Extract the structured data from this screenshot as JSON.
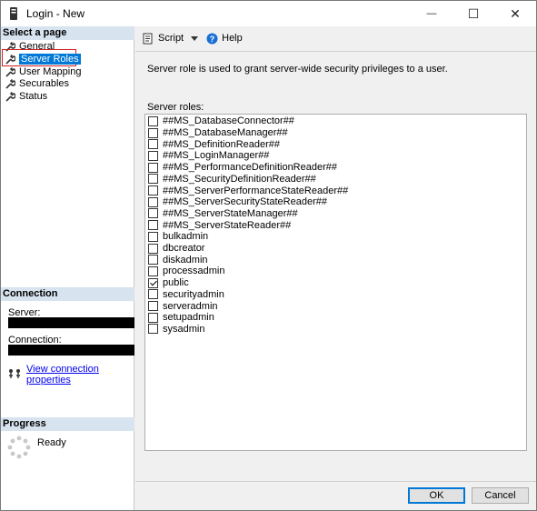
{
  "window": {
    "title": "Login - New",
    "controls": {
      "minimize": "—",
      "maximize": "☐",
      "close": "✕"
    }
  },
  "left": {
    "select_page_header": "Select a page",
    "pages": [
      {
        "label": "General",
        "icon": "wrench-icon",
        "selected": false
      },
      {
        "label": "Server Roles",
        "icon": "wrench-icon",
        "selected": true
      },
      {
        "label": "User Mapping",
        "icon": "wrench-icon",
        "selected": false
      },
      {
        "label": "Securables",
        "icon": "wrench-icon",
        "selected": false
      },
      {
        "label": "Status",
        "icon": "wrench-icon",
        "selected": false
      }
    ],
    "connection_header": "Connection",
    "server_label": "Server:",
    "connection_label": "Connection:",
    "view_connection_link": "View connection properties",
    "progress_header": "Progress",
    "progress_status": "Ready"
  },
  "toolbar": {
    "script_label": "Script",
    "help_label": "Help"
  },
  "main": {
    "description": "Server role is used to grant server-wide security privileges to a user.",
    "roles_label": "Server roles:",
    "roles": [
      {
        "name": "##MS_DatabaseConnector##",
        "checked": false
      },
      {
        "name": "##MS_DatabaseManager##",
        "checked": false
      },
      {
        "name": "##MS_DefinitionReader##",
        "checked": false
      },
      {
        "name": "##MS_LoginManager##",
        "checked": false
      },
      {
        "name": "##MS_PerformanceDefinitionReader##",
        "checked": false
      },
      {
        "name": "##MS_SecurityDefinitionReader##",
        "checked": false
      },
      {
        "name": "##MS_ServerPerformanceStateReader##",
        "checked": false
      },
      {
        "name": "##MS_ServerSecurityStateReader##",
        "checked": false
      },
      {
        "name": "##MS_ServerStateManager##",
        "checked": false
      },
      {
        "name": "##MS_ServerStateReader##",
        "checked": false
      },
      {
        "name": "bulkadmin",
        "checked": false
      },
      {
        "name": "dbcreator",
        "checked": false
      },
      {
        "name": "diskadmin",
        "checked": false
      },
      {
        "name": "processadmin",
        "checked": false
      },
      {
        "name": "public",
        "checked": true
      },
      {
        "name": "securityadmin",
        "checked": false
      },
      {
        "name": "serveradmin",
        "checked": false
      },
      {
        "name": "setupadmin",
        "checked": false
      },
      {
        "name": "sysadmin",
        "checked": false
      }
    ]
  },
  "buttons": {
    "ok": "OK",
    "cancel": "Cancel"
  },
  "colors": {
    "selected_bg": "#0078d7",
    "section_header_bg": "#d7e3ef",
    "selection_frame": "#d02020",
    "link": "#0000ee"
  }
}
